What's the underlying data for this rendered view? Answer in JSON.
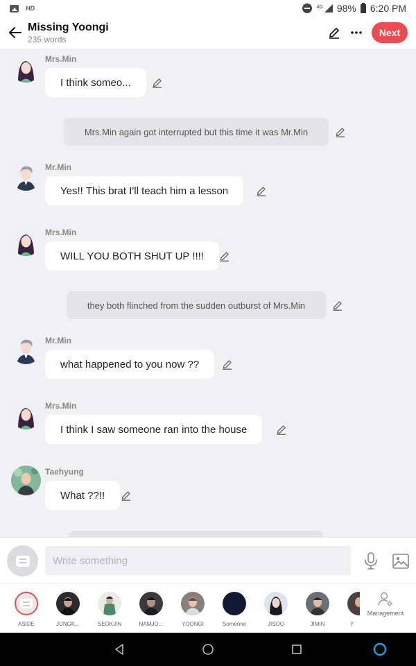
{
  "status_bar": {
    "hd_label": "HD",
    "network": "4G",
    "battery": "98%",
    "time": "6:20 PM"
  },
  "header": {
    "title": "Missing Yoongi",
    "subtitle": "235 words",
    "next_label": "Next"
  },
  "messages": [
    {
      "type": "character",
      "name": "Mrs.Min",
      "text": "I think someo..."
    },
    {
      "type": "narration",
      "text": "Mrs.Min again got interrupted but this time it was Mr.Min"
    },
    {
      "type": "character",
      "name": "Mr.Min",
      "text": "Yes!! This brat I'll teach him a lesson"
    },
    {
      "type": "character",
      "name": "Mrs.Min",
      "text": "WILL YOU BOTH SHUT UP !!!!"
    },
    {
      "type": "narration",
      "text": "they both flinched from the sudden outburst of Mrs.Min"
    },
    {
      "type": "character",
      "name": "Mr.Min",
      "text": "what happened to you now ??"
    },
    {
      "type": "character",
      "name": "Mrs.Min",
      "text": "I think I saw someone ran into the house"
    },
    {
      "type": "character",
      "name": "Taehyung",
      "text": "What ??!!"
    }
  ],
  "input_bar": {
    "placeholder": "Write something"
  },
  "characters": [
    {
      "label": "ASIDE"
    },
    {
      "label": "JUNGK..."
    },
    {
      "label": "SEOKJIN"
    },
    {
      "label": "NAMJO..."
    },
    {
      "label": "YOONGI"
    },
    {
      "label": "Someone"
    },
    {
      "label": "JISOO"
    },
    {
      "label": "JIMIN"
    },
    {
      "label": "Y"
    }
  ],
  "management_label": "Management",
  "colors": {
    "accent": "#f04950",
    "background": "#f1f1f3",
    "bubble": "#ffffff",
    "narration": "#e4e4e7"
  }
}
